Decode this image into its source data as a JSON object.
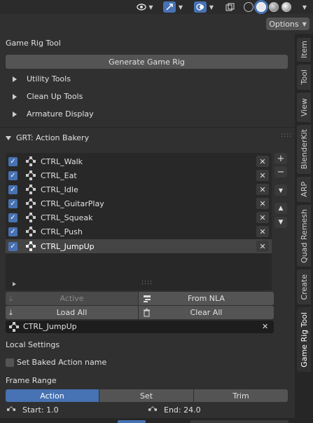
{
  "header": {
    "options_label": "Options"
  },
  "panel": {
    "title": "Game Rig Tool",
    "generate_label": "Generate Game Rig",
    "subpanels": [
      "Utility Tools",
      "Clean Up Tools",
      "Armature Display"
    ]
  },
  "bakery": {
    "title": "GRT: Action Bakery",
    "actions": [
      {
        "name": "CTRL_Walk"
      },
      {
        "name": "CTRL_Eat"
      },
      {
        "name": "CTRL_Idle"
      },
      {
        "name": "CTRL_GuitarPlay"
      },
      {
        "name": "CTRL_Squeak"
      },
      {
        "name": "CTRL_Push"
      },
      {
        "name": "CTRL_JumpUp"
      }
    ],
    "active_label": "Active",
    "from_nla_label": "From NLA",
    "load_all_label": "Load All",
    "clear_all_label": "Clear All",
    "current_action": "CTRL_JumpUp"
  },
  "local_settings": {
    "title": "Local Settings",
    "set_baked_label": "Set Baked Action name",
    "set_baked_checked": false
  },
  "frame_range": {
    "title": "Frame Range",
    "modes": [
      "Action",
      "Set",
      "Trim"
    ],
    "active_mode": "Action",
    "start_label": "Start: 1.0",
    "end_label": "End: 24.0"
  },
  "tabs": [
    "Item",
    "Tool",
    "View",
    "BlenderKit",
    "ARP",
    "Quad Remesh",
    "Create",
    "Game Rig Tool"
  ],
  "active_tab": "Game Rig Tool",
  "colors": {
    "accent": "#4772b3",
    "panel": "#303030",
    "button": "#545454"
  }
}
